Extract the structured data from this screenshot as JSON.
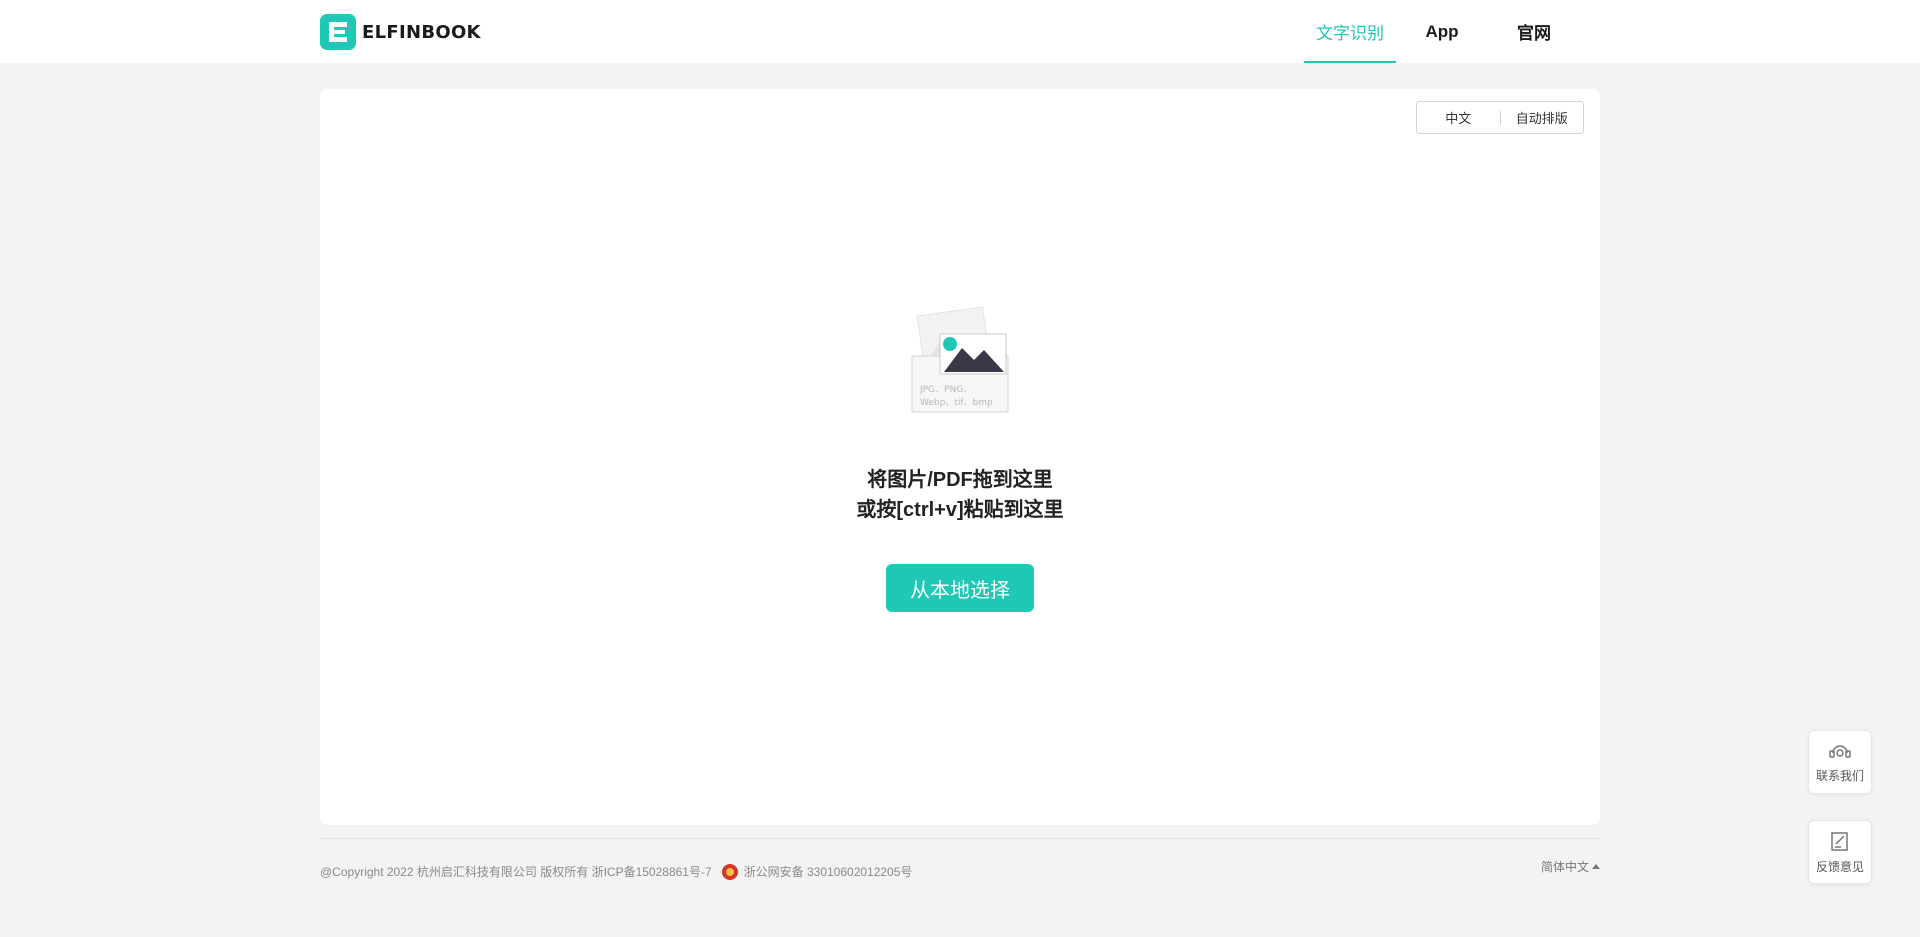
{
  "header": {
    "logo_text": "ELFINBOOK",
    "nav": [
      "文字识别",
      "App",
      "官网"
    ],
    "active_color": "#1ec8b5"
  },
  "card": {
    "language_option": "中文",
    "layout_option": "自动排版",
    "illustration_formats_line1": "JPG、PNG、",
    "illustration_formats_line2": "Webp、tif、bmp",
    "drop_line1": "将图片/PDF拖到这里",
    "drop_line2": "或按[ctrl+v]粘贴到这里",
    "choose_button": "从本地选择"
  },
  "footer": {
    "copyright": "@Copyright 2022 杭州启汇科技有限公司 版权所有 浙ICP备15028861号-7",
    "police_record": "浙公网安备 33010602012205号",
    "language": "简体中文"
  },
  "float": {
    "contact": "联系我们",
    "feedback": "反馈意见"
  },
  "icons": [
    "logo-icon",
    "image-upload-icon",
    "police-badge-icon",
    "headset-icon",
    "edit-note-icon",
    "caret-up-icon"
  ]
}
